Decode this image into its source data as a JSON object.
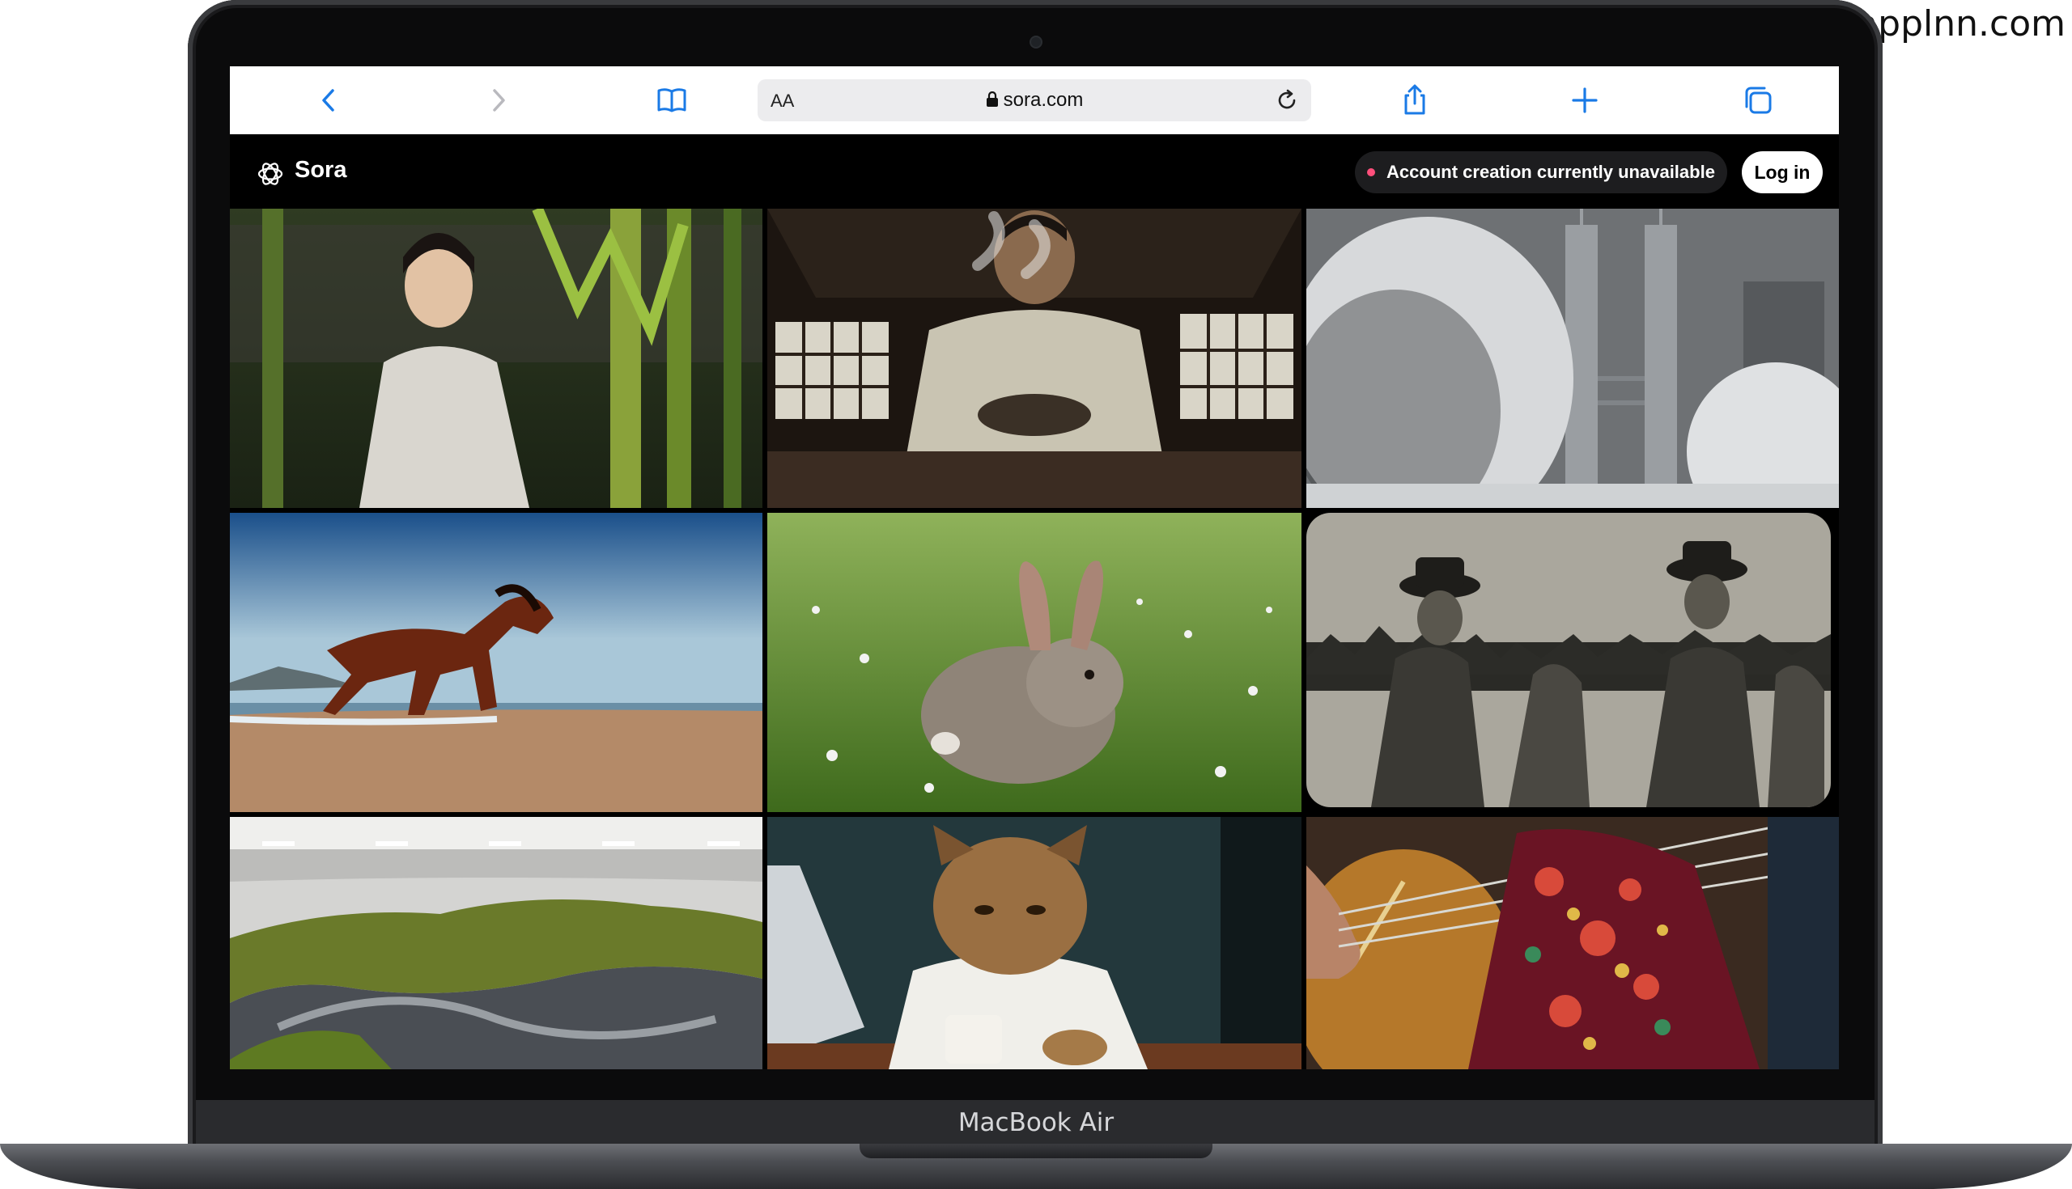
{
  "watermark": "applnn.com",
  "device": {
    "label": "MacBook Air"
  },
  "browser": {
    "address": {
      "reader_label": "AA",
      "url": "sora.com"
    },
    "icons": [
      "chevron-left-icon",
      "chevron-right-icon",
      "bookmarks-icon",
      "lock-icon",
      "reload-icon",
      "share-icon",
      "plus-icon",
      "tabs-icon"
    ]
  },
  "site": {
    "brand": "Sora",
    "notice": "Account creation currently unavailable",
    "login_label": "Log in"
  },
  "colors": {
    "notice_dot": "#ff4f7b",
    "toolbar_icon": "#1a7ae6",
    "page_bg": "#000000"
  },
  "gallery": {
    "tiles": [
      "woman-in-bamboo-grove",
      "man-holding-steaming-tea-bowl",
      "snowy-trees-and-towers",
      "horse-galloping-on-beach",
      "rabbit-in-grass",
      "cowboys-on-horses-sepia",
      "miniature-landscape-in-gallery",
      "cat-in-shirt-with-coffee",
      "embroidered-guitar-player"
    ]
  }
}
